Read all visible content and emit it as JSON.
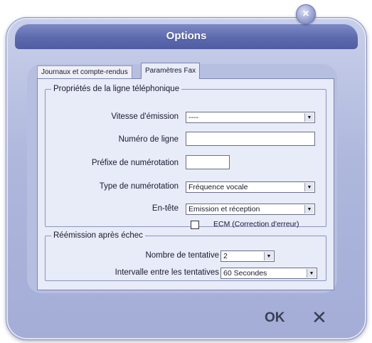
{
  "window": {
    "title": "Options",
    "close_symbol": "×"
  },
  "tabs": [
    {
      "label": "Journaux et compte-rendus"
    },
    {
      "label": "Paramètres Fax"
    }
  ],
  "line_properties": {
    "legend": "Propriétés de la ligne téléphonique",
    "speed": {
      "label": "Vitesse d'émission",
      "value": "----"
    },
    "line_number": {
      "label": "Numéro de ligne",
      "value": ""
    },
    "prefix": {
      "label": "Préfixe de numérotation",
      "value": ""
    },
    "dial_type": {
      "label": "Type de numérotation",
      "value": "Fréquence vocale"
    },
    "header": {
      "label": "En-tête",
      "value": "Emission et réception"
    },
    "ecm": {
      "label": "ECM (Correction d'erreur)",
      "checked": false
    }
  },
  "resend": {
    "legend": "Réémission après échec",
    "attempts": {
      "label": "Nombre de tentative",
      "value": "2"
    },
    "interval": {
      "label": "Intervalle entre les tentatives",
      "value": "60 Secondes"
    }
  },
  "buttons": {
    "ok": "OK",
    "cancel": "✕"
  },
  "icons": {
    "dropdown": "▼"
  }
}
